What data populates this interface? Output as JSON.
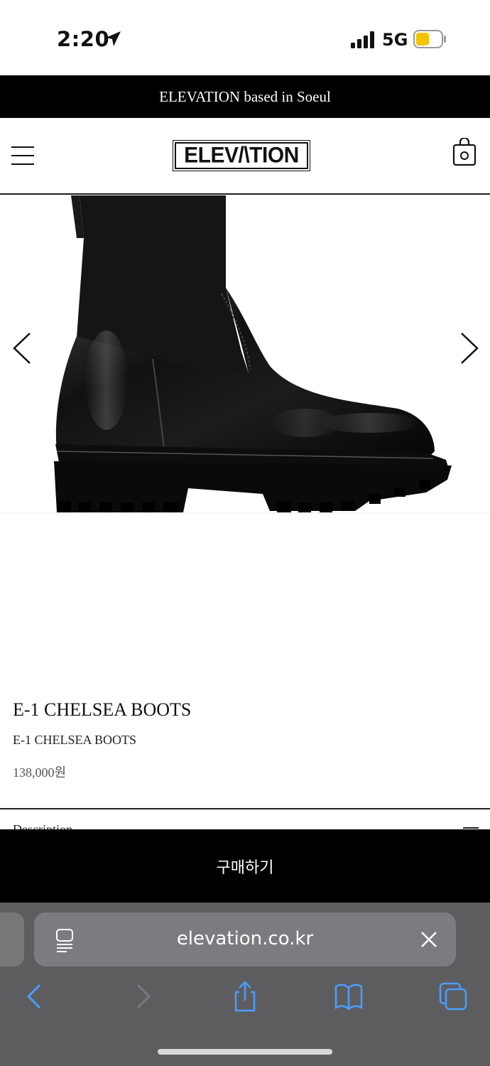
{
  "status_bar": {
    "time": "2:20",
    "network": "5G",
    "icons": [
      "location-arrow-icon",
      "signal-bars-icon",
      "battery-icon"
    ],
    "battery_color": "#f5c400"
  },
  "announcement": {
    "text": "ELEVATION based in Soeul"
  },
  "header": {
    "logo_text": "ELEV/\\TION",
    "icons": [
      "hamburger-menu-icon",
      "shopping-bag-icon"
    ]
  },
  "gallery": {
    "image": "black-chelsea-boot-photo",
    "icons": [
      "chevron-left-icon",
      "chevron-right-icon"
    ]
  },
  "product": {
    "name": "E-1 CHELSEA BOOTS",
    "subtitle": "E-1 CHELSEA BOOTS",
    "price": "138,000원"
  },
  "description": {
    "label": "Description"
  },
  "buy_button": {
    "label": "구매하기"
  },
  "browser": {
    "url": "elevation.co.kr",
    "icons": [
      "reader-icon",
      "clear-icon",
      "back-icon",
      "forward-icon",
      "share-icon",
      "bookmarks-icon",
      "tabs-icon"
    ],
    "accent": "#4a9eff"
  },
  "colors": {
    "brand_black": "#000000",
    "background": "#ffffff",
    "browser_bar": "#5d5d60"
  }
}
